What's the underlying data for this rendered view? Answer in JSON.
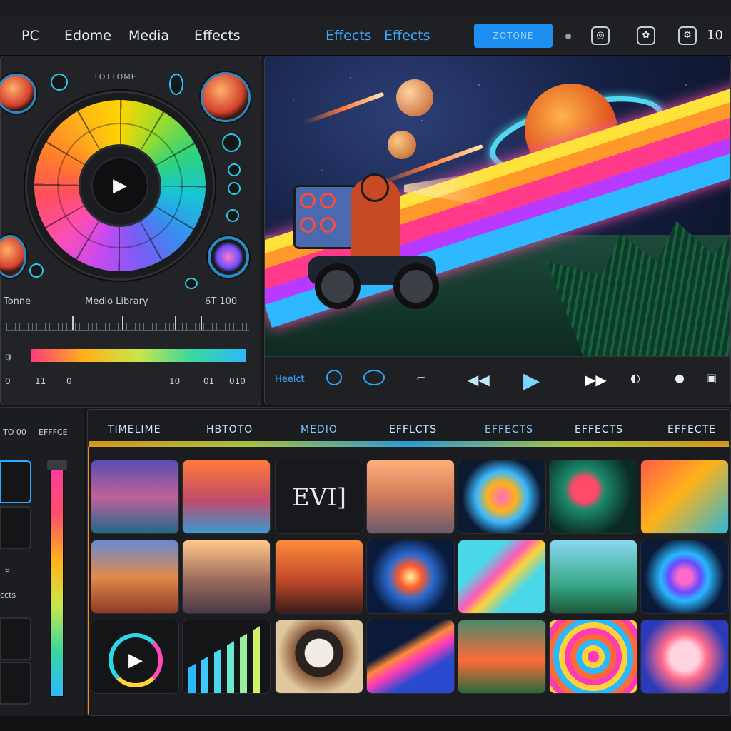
{
  "menu": {
    "items": [
      "PC",
      "Edome",
      "Media",
      "Effects"
    ],
    "center": [
      "Effects",
      "Effects"
    ],
    "button": "ZOTONE",
    "count": "10"
  },
  "effects_panel": {
    "wheel_title": "TOTTOME",
    "label_left": "Tonne",
    "label_center": "Medio Library",
    "label_right": "6T  100",
    "nums": [
      "0",
      "11",
      "0",
      "10",
      "01",
      "010"
    ]
  },
  "transport": {
    "label": "Heelct"
  },
  "sidebar": {
    "label_top_left": "TO 00",
    "label_top_right": "EFFFCE",
    "item_labels": [
      "ie",
      "ccts"
    ]
  },
  "library": {
    "tabs": [
      "TIMELIME",
      "HBTOTO",
      "MEDIO",
      "EFFLCTS",
      "EFFECTS",
      "EFFECTS",
      "EFFECTE"
    ],
    "thumbs": [
      {
        "label": "EVI]"
      }
    ]
  },
  "colors": {
    "accent": "#1c8ef0",
    "timeline_bar": "#ff8a1a"
  },
  "icons": [
    "play-icon",
    "rewind-icon",
    "fast-forward-icon",
    "settings-icon",
    "record-icon",
    "camera-icon"
  ]
}
